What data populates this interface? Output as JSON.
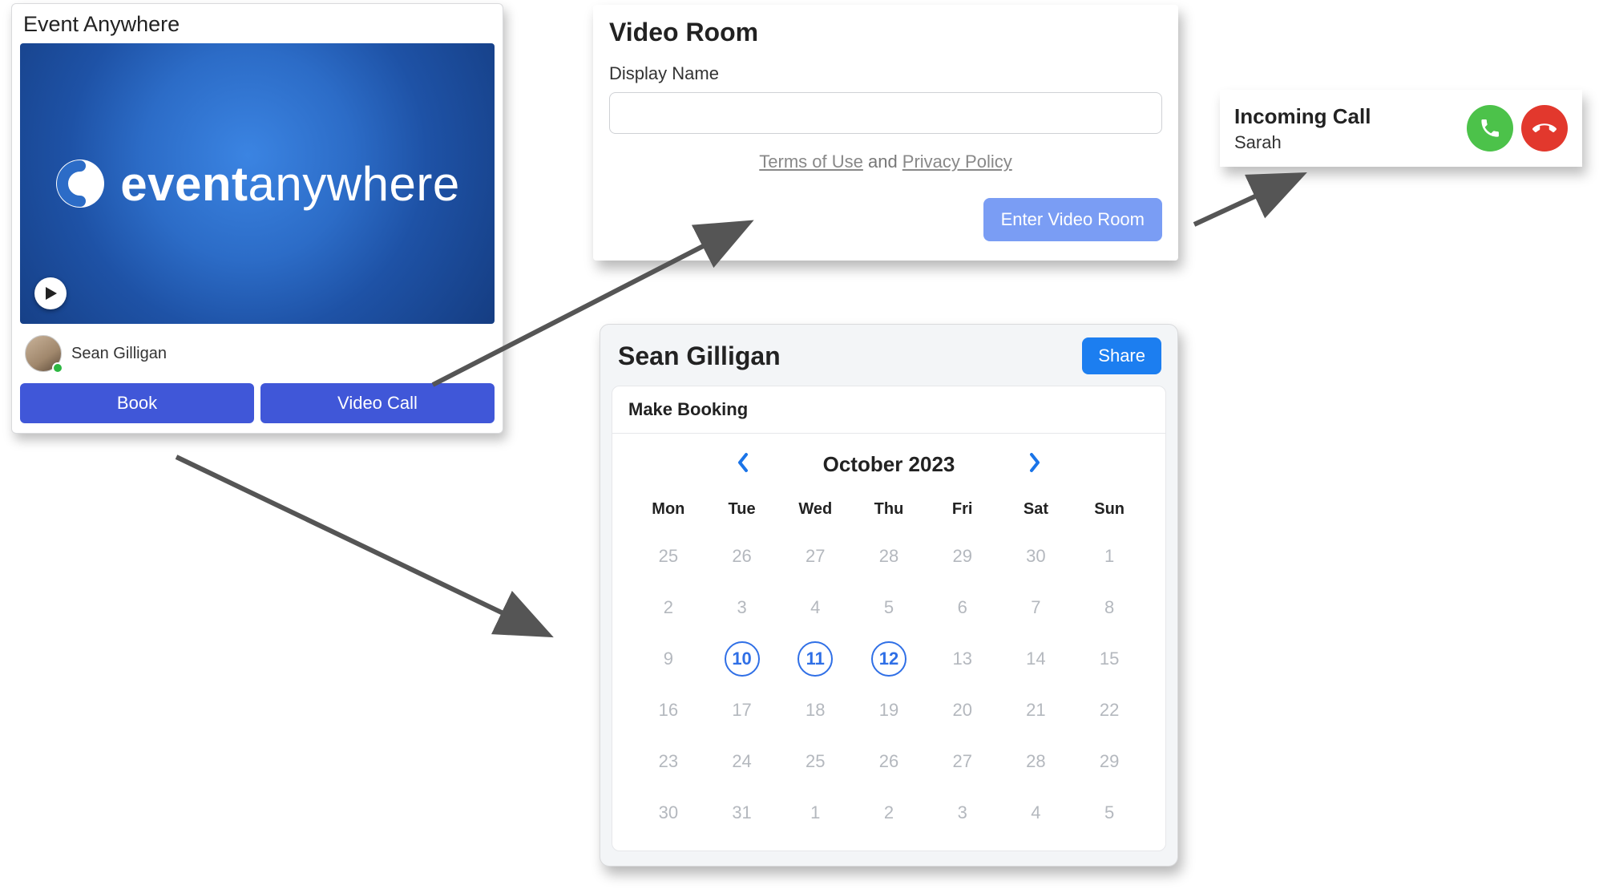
{
  "eventCard": {
    "title": "Event Anywhere",
    "logo_bold": "event",
    "logo_light": "anywhere",
    "user_name": "Sean Gilligan",
    "book_label": "Book",
    "videocall_label": "Video Call"
  },
  "videoRoom": {
    "title": "Video Room",
    "display_name_label": "Display Name",
    "display_name_value": "",
    "terms_label": "Terms of Use",
    "and_label": " and ",
    "privacy_label": "Privacy Policy",
    "enter_label": "Enter Video Room"
  },
  "incoming": {
    "title": "Incoming Call",
    "caller": "Sarah"
  },
  "booking": {
    "person": "Sean Gilligan",
    "share_label": "Share",
    "make_label": "Make Booking",
    "month_label": "October 2023",
    "dow": [
      "Mon",
      "Tue",
      "Wed",
      "Thu",
      "Fri",
      "Sat",
      "Sun"
    ],
    "weeks": [
      [
        {
          "n": 25,
          "in": false
        },
        {
          "n": 26,
          "in": false
        },
        {
          "n": 27,
          "in": false
        },
        {
          "n": 28,
          "in": false
        },
        {
          "n": 29,
          "in": false
        },
        {
          "n": 30,
          "in": false
        },
        {
          "n": 1,
          "in": true
        }
      ],
      [
        {
          "n": 2,
          "in": true
        },
        {
          "n": 3,
          "in": true
        },
        {
          "n": 4,
          "in": true
        },
        {
          "n": 5,
          "in": true
        },
        {
          "n": 6,
          "in": true
        },
        {
          "n": 7,
          "in": true
        },
        {
          "n": 8,
          "in": true
        }
      ],
      [
        {
          "n": 9,
          "in": true
        },
        {
          "n": 10,
          "in": true,
          "avail": true
        },
        {
          "n": 11,
          "in": true,
          "avail": true
        },
        {
          "n": 12,
          "in": true,
          "avail": true
        },
        {
          "n": 13,
          "in": true
        },
        {
          "n": 14,
          "in": true
        },
        {
          "n": 15,
          "in": true
        }
      ],
      [
        {
          "n": 16,
          "in": true
        },
        {
          "n": 17,
          "in": true
        },
        {
          "n": 18,
          "in": true
        },
        {
          "n": 19,
          "in": true
        },
        {
          "n": 20,
          "in": true
        },
        {
          "n": 21,
          "in": true
        },
        {
          "n": 22,
          "in": true
        }
      ],
      [
        {
          "n": 23,
          "in": true
        },
        {
          "n": 24,
          "in": true
        },
        {
          "n": 25,
          "in": true
        },
        {
          "n": 26,
          "in": true
        },
        {
          "n": 27,
          "in": true
        },
        {
          "n": 28,
          "in": true
        },
        {
          "n": 29,
          "in": true
        }
      ],
      [
        {
          "n": 30,
          "in": true
        },
        {
          "n": 31,
          "in": true
        },
        {
          "n": 1,
          "in": false
        },
        {
          "n": 2,
          "in": false
        },
        {
          "n": 3,
          "in": false
        },
        {
          "n": 4,
          "in": false
        },
        {
          "n": 5,
          "in": false
        }
      ]
    ]
  }
}
